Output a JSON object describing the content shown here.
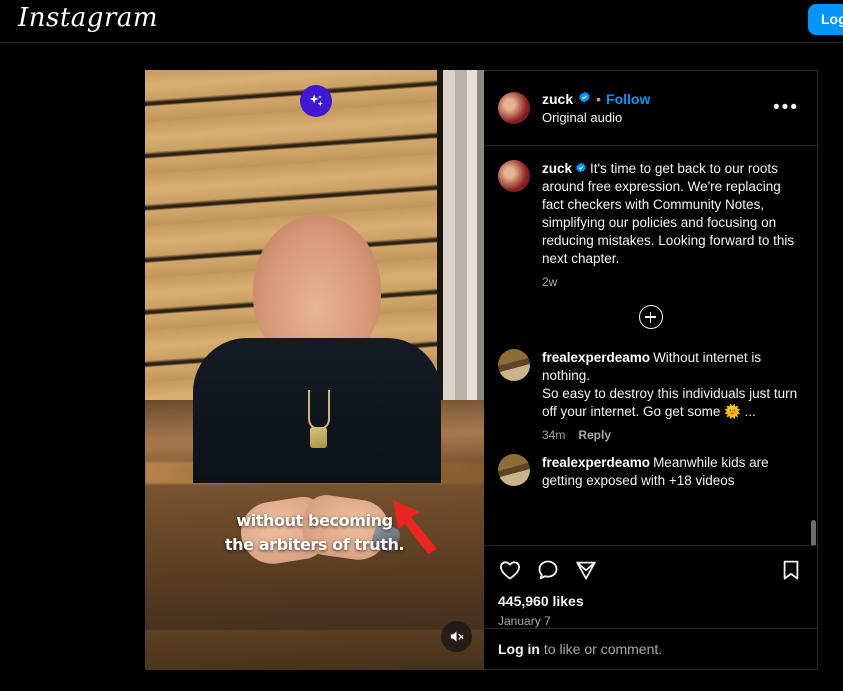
{
  "nav": {
    "logo": "Instagram",
    "login_button": "Log in"
  },
  "post": {
    "header": {
      "username": "zuck",
      "verified_icon": "verified-badge-icon",
      "separator": "•",
      "follow_label": "Follow",
      "subtitle": "Original audio",
      "more_label": "•••"
    },
    "media": {
      "ai_icon": "sparkle-icon",
      "mute_icon": "mute-speaker-icon",
      "caption_line1": "without becoming",
      "caption_line2": "the arbiters of truth.",
      "annotation_icon": "red-arrow-annotation"
    },
    "caption": {
      "username": "zuck",
      "text": "It's time to get back to our roots around free expression. We're replacing fact checkers with Community Notes, simplifying our policies and focusing on reducing mistakes. Looking forward to this next chapter.",
      "time": "2w"
    },
    "load_more_icon": "plus-circle-icon",
    "comments": [
      {
        "username": "frealexperdeamo",
        "text": "Without internet is nothing.\nSo easy to destroy this individuals just turn off your internet. Go get some 🌞 ...",
        "time": "34m",
        "reply_label": "Reply"
      },
      {
        "username": "frealexperdeamo",
        "text": "Meanwhile kids are getting exposed with +18 videos",
        "time": "",
        "reply_label": ""
      }
    ],
    "actions": {
      "like_icon": "heart-icon",
      "comment_icon": "comment-bubble-icon",
      "share_icon": "share-paper-plane-icon",
      "save_icon": "bookmark-icon"
    },
    "likes": "445,960 likes",
    "date": "January 7",
    "login_prompt": {
      "link": "Log in",
      "rest": " to like or comment."
    }
  },
  "colors": {
    "accent_blue": "#0095f6",
    "ai_purple": "#3f18d4",
    "annotation_red": "#e8251f",
    "background": "#000000",
    "border": "#2b2b2b",
    "muted_text": "#a8a8a8"
  }
}
